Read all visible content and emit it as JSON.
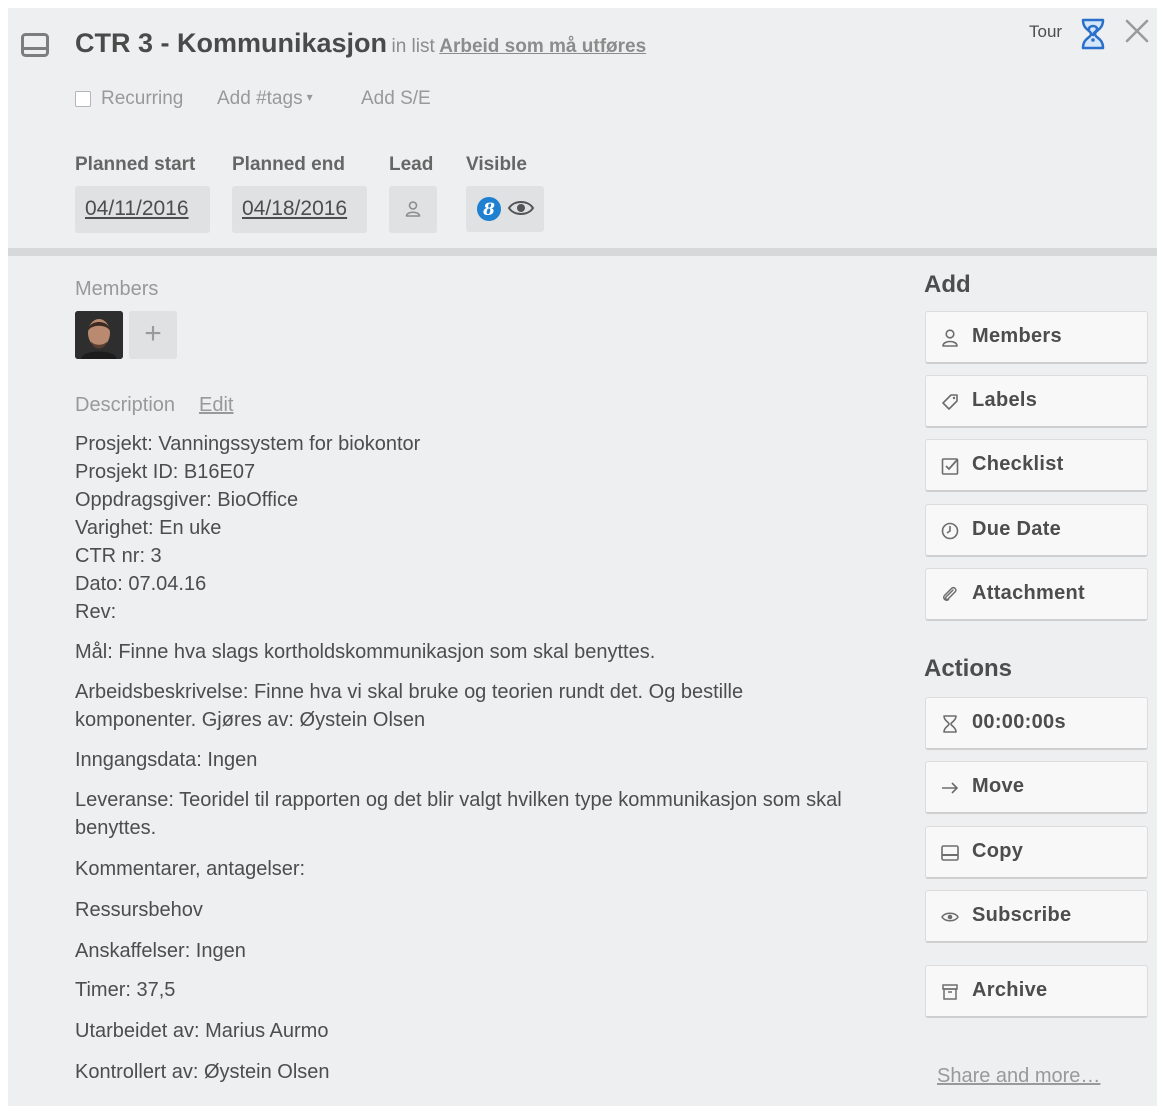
{
  "header": {
    "title": "CTR 3 - Kommunikasjon",
    "in_list_prefix": "in list",
    "list_name": "Arbeid som må utføres",
    "tour_label": "Tour"
  },
  "subbar": {
    "recurring_label": "Recurring",
    "recurring_checked": false,
    "tags_label": "Add #tags",
    "tags_caret": "▾",
    "se_label": "Add S/E"
  },
  "fields": {
    "planned_start_label": "Planned start",
    "planned_start_value": "04/11/2016",
    "planned_end_label": "Planned end",
    "planned_end_value": "04/18/2016",
    "lead_label": "Lead",
    "visible_label": "Visible",
    "visible_badge": "8"
  },
  "members": {
    "label": "Members",
    "add_symbol": "+"
  },
  "description": {
    "label": "Description",
    "edit_label": "Edit",
    "header_lines": [
      "Prosjekt: Vanningssystem for biokontor",
      "Prosjekt ID: B16E07",
      "Oppdragsgiver: BioOffice",
      "Varighet: En uke",
      "CTR nr: 3",
      "Dato: 07.04.16",
      "Rev:"
    ],
    "maal": "Mål: Finne hva slags kortholdskommunikasjon som skal benyttes.",
    "arbeid": "Arbeidsbeskrivelse: Finne hva vi skal bruke og teorien rundt det. Og bestille komponenter. Gjøres av: Øystein Olsen",
    "inngang": "Inngangsdata: Ingen",
    "leveranse": "Leveranse: Teoridel til rapporten og det blir valgt hvilken type kommunikasjon som skal benyttes.",
    "kommentarer": "Kommentarer, antagelser:",
    "ressurs": "Ressursbehov",
    "anskaffelser": "Anskaffelser: Ingen",
    "timer": "Timer: 37,5",
    "utarbeidet": "Utarbeidet av: Marius Aurmo",
    "kontrollert": "Kontrollert av: Øystein Olsen"
  },
  "sidebar": {
    "add_heading": "Add",
    "add_buttons": [
      {
        "label": "Members",
        "icon": "person-icon"
      },
      {
        "label": "Labels",
        "icon": "tag-icon"
      },
      {
        "label": "Checklist",
        "icon": "checkbox-icon"
      },
      {
        "label": "Due Date",
        "icon": "clock-icon"
      },
      {
        "label": "Attachment",
        "icon": "paperclip-icon"
      }
    ],
    "actions_heading": "Actions",
    "action_buttons": [
      {
        "label": "00:00:00s",
        "icon": "hourglass-icon"
      },
      {
        "label": "Move",
        "icon": "arrow-right-icon"
      },
      {
        "label": "Copy",
        "icon": "card-icon"
      },
      {
        "label": "Subscribe",
        "icon": "eye-icon"
      },
      {
        "label": "Archive",
        "icon": "archive-icon"
      }
    ],
    "share_label": "Share and more…"
  },
  "colors": {
    "card_bg": "#edeff0",
    "field_bg": "#dfe1e3",
    "badge_blue": "#1f7fd0",
    "tour_blue": "#2a6fc9"
  }
}
